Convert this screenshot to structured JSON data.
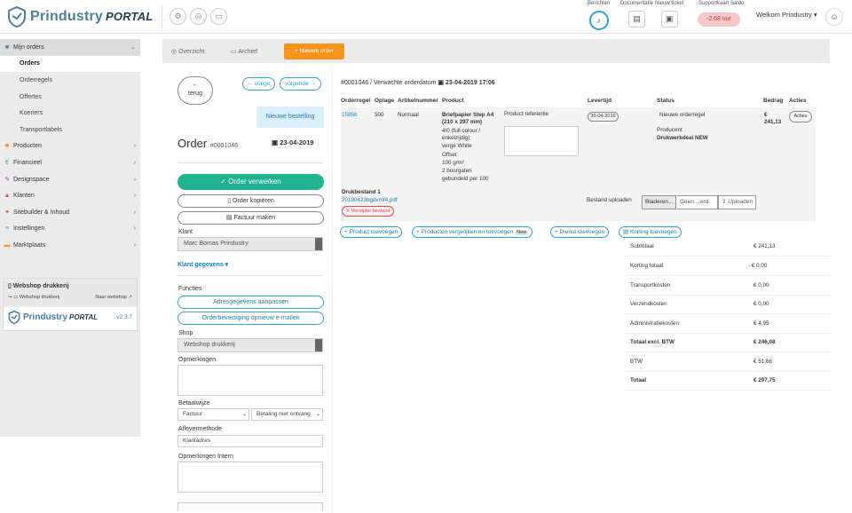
{
  "brand": {
    "name": "Prindustry",
    "portal": "PORTAL"
  },
  "topnav": {
    "items": [
      {
        "label": "Berichten",
        "icon": "bell-icon"
      },
      {
        "label": "Documentatie",
        "icon": "document-icon"
      },
      {
        "label": "Nieuw ticket",
        "icon": "ticket-icon"
      },
      {
        "label": "Supportkaart Saldo",
        "icon": "card-icon"
      }
    ],
    "saldo": "-2.68 uur",
    "welcome": "Welkom Prindustry ▾"
  },
  "sidebar": {
    "sections": [
      {
        "label": "Mijn orders",
        "color": "#4a7fa3"
      },
      {
        "label": "Producten",
        "color": "#f7941d"
      },
      {
        "label": "Financieel",
        "color": "#1fb48f"
      },
      {
        "label": "Designspace",
        "color": "#8e44ad"
      },
      {
        "label": "Klanten",
        "color": "#e74c3c"
      },
      {
        "label": "Sitebuilder & Inhoud",
        "color": "#e74c3c"
      },
      {
        "label": "Instellingen",
        "color": "#2ea3d8"
      },
      {
        "label": "Marktplaats",
        "color": "#f7941d"
      }
    ],
    "subitems": [
      "Orders",
      "Orderregels",
      "Offertes",
      "Koeriers",
      "Transportlabels"
    ],
    "webshop": {
      "title": "Webshop drukkerij",
      "link_left": "Webshop drukkerij",
      "link_right": "Naar webshop",
      "version": "v2.3.7"
    }
  },
  "tabs": {
    "overview": "Overzicht",
    "archive": "Archief",
    "new_order": "+ Nieuwe order"
  },
  "left": {
    "back": "terug",
    "prev": "← vorige",
    "next": "volgende →",
    "new_badge": "Nieuwe bestelling",
    "order_label": "Order",
    "order_no": "#0001046",
    "order_date": "23-04-2019",
    "process": "✓ Order verwerken",
    "copy": "Order kopiëren",
    "invoice": "Factuur maken",
    "klant_label": "Klant",
    "klant_value": "Marc Bomas Prindustry",
    "klant_link": "Klant gegevens ▾",
    "functies": "Functies",
    "adres": "Adresgegevens aanpassen",
    "bevestiging": "Orderbevestiging opnieuw e-mailen",
    "shop_label": "Shop",
    "shop_value": "Webshop drukkerij",
    "opm_label": "Opmerkingen",
    "betaal_label": "Betaalwijze",
    "betaal_value": "Factuur",
    "betaal_status": "Betaling niet ontvang",
    "aflever_label": "Aflevermethode",
    "aflever_value": "Klantadres",
    "opm_intern": "Opmerkingen Intern"
  },
  "main": {
    "crumb_order": "#0001046",
    "crumb_text": "/ Verwachte orderdatum",
    "crumb_date": "23-04-2019 17:06",
    "headers": [
      "Orderregel",
      "Oplage",
      "Artikelnummer",
      "Product",
      "Levertijd",
      "Status",
      "Bedrag",
      "Acties"
    ],
    "row": {
      "id": "15856",
      "oplage": "500",
      "artikel": "Normaal",
      "product_title": "Briefpapier Step A4 (210 x 297 mm)",
      "product_desc": [
        "4/0 (full colour / enkelzijdig)",
        "vergé White",
        "Offset",
        "100 g/m²",
        "2 boorgaten",
        "gebundeld per 100"
      ],
      "ref_label": "Product referentie",
      "levertijd": "30-04-2019",
      "status": "Nieuwe orderregel",
      "producent_label": "Producent",
      "producent": "Drukwerkdeal NEW",
      "bedrag": "€ 241,13",
      "actie": "Acties"
    },
    "file": {
      "label": "Drukbestand 1",
      "name": "20190423bgdvmf4.pdf",
      "remove": "✕ Verwijder bestand",
      "upload_label": "Bestand uploaden",
      "browse": "Bladeren...",
      "none": "Geen ...erd.",
      "upload": "⇪ Uploaden"
    },
    "add": {
      "product": "+ Product toevoegen",
      "compare": "+ Producten vergelijken en toevoegen",
      "new": "New",
      "service": "+ Dienst toevoegen",
      "discount": "Korting toevoegen"
    },
    "totals": [
      {
        "label": "Subtotaal",
        "value": "€ 241,13",
        "bold": false
      },
      {
        "label": "Korting totaal",
        "value": "- € 0,00",
        "bold": false
      },
      {
        "label": "Transportkosten",
        "value": "€ 0,00",
        "bold": false
      },
      {
        "label": "Verzendkosten",
        "value": "€ 0,00",
        "bold": false
      },
      {
        "label": "Administratiekosten",
        "value": "€ 4,95",
        "bold": false
      },
      {
        "label": "Totaal excl. BTW",
        "value": "€ 246,08",
        "bold": true
      },
      {
        "label": "BTW",
        "value": "€ 51,68",
        "bold": false
      },
      {
        "label": "Totaal",
        "value": "€ 297,75",
        "bold": true
      }
    ]
  }
}
